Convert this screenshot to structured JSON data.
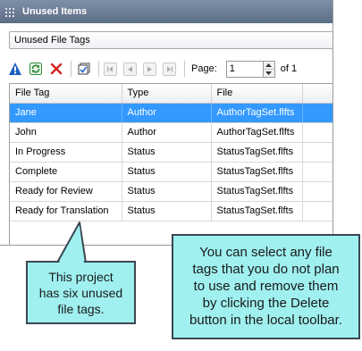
{
  "panel": {
    "title": "Unused Items"
  },
  "filter_dropdown": {
    "value": "Unused File Tags"
  },
  "toolbar": {
    "buttons": [
      {
        "icon": "properties-icon",
        "color": "#1f5fbf"
      },
      {
        "icon": "refresh-icon",
        "color": "#2e8b3a"
      },
      {
        "icon": "delete-icon",
        "color": "#d42020"
      },
      {
        "icon": "select-icon",
        "color": "#404040"
      }
    ],
    "nav": [
      "first-page-icon",
      "previous-page-icon",
      "next-page-icon",
      "last-page-icon"
    ],
    "page_label": "Page:",
    "page_value": "1",
    "of_label": "of 1"
  },
  "grid": {
    "columns": [
      "File Tag",
      "Type",
      "File"
    ],
    "rows": [
      [
        "Jane",
        "Author",
        "AuthorTagSet.flfts"
      ],
      [
        "John",
        "Author",
        "AuthorTagSet.flfts"
      ],
      [
        "In Progress",
        "Status",
        "StatusTagSet.flfts"
      ],
      [
        "Complete",
        "Status",
        "StatusTagSet.flfts"
      ],
      [
        "Ready for Review",
        "Status",
        "StatusTagSet.flfts"
      ],
      [
        "Ready for Translation",
        "Status",
        "StatusTagSet.flfts"
      ]
    ],
    "selected_row": 0,
    "selection_color": "#3399ff"
  },
  "callouts": {
    "left": {
      "lines": [
        "This project",
        "has six unused",
        "file tags."
      ]
    },
    "right": {
      "lines": [
        "You can select any file",
        "tags that you do not plan",
        "to use and remove them",
        "by clicking the Delete",
        "button in the local toolbar."
      ]
    },
    "fill_color": "#9ff0ef"
  }
}
